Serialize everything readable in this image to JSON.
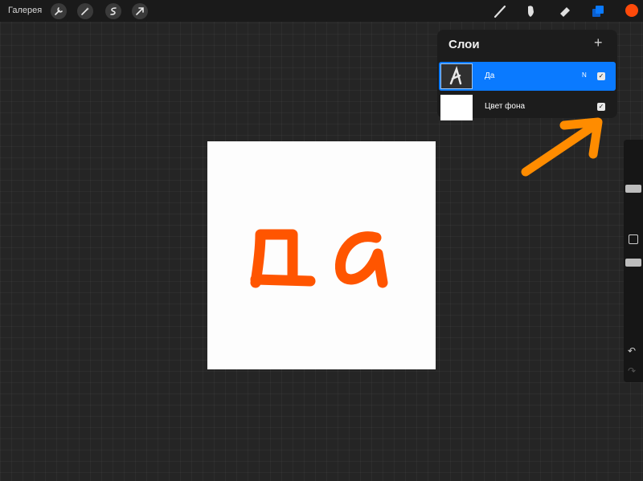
{
  "topbar": {
    "gallery_label": "Галерея",
    "left_icons": [
      "wrench-icon",
      "magic-wand-icon",
      "selection-icon",
      "transform-arrow-icon"
    ],
    "right_icons": [
      "brush-icon",
      "smudge-icon",
      "eraser-icon",
      "layers-icon"
    ],
    "current_color": "#ff4a0a"
  },
  "canvas": {
    "text": "Да",
    "text_color": "#ff5500",
    "background": "#fdfdfd"
  },
  "layers_panel": {
    "title": "Слои",
    "add_symbol": "+",
    "layers": [
      {
        "name": "Да",
        "mode": "N",
        "visible": true,
        "selected": true
      },
      {
        "name": "Цвет фона",
        "visible": true,
        "selected": false
      }
    ]
  },
  "sidebar": {
    "undo_symbol": "↶",
    "redo_symbol": "↷"
  },
  "annotation": {
    "arrow_color": "#ff8c00"
  }
}
